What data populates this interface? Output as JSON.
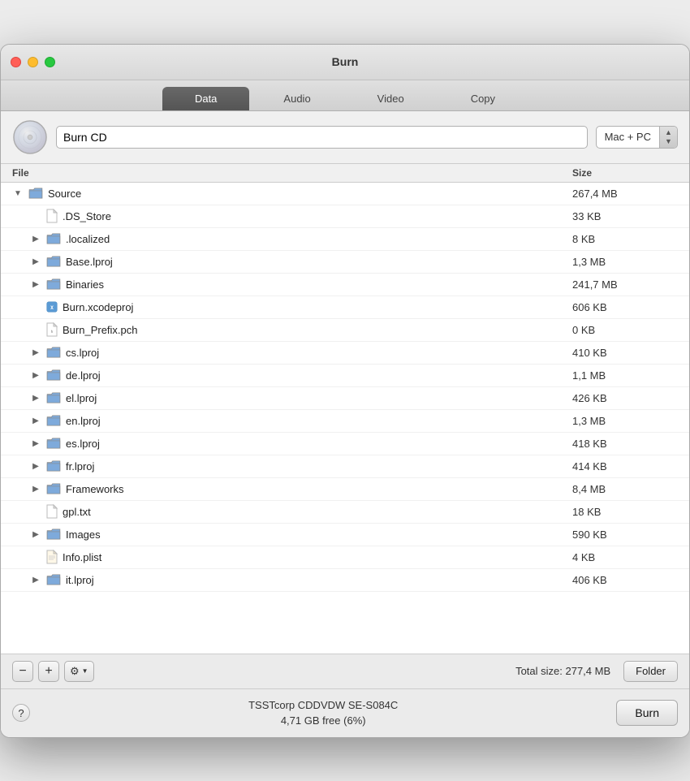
{
  "window": {
    "title": "Burn"
  },
  "tabs": [
    {
      "id": "data",
      "label": "Data",
      "active": true
    },
    {
      "id": "audio",
      "label": "Audio",
      "active": false
    },
    {
      "id": "video",
      "label": "Video",
      "active": false
    },
    {
      "id": "copy",
      "label": "Copy",
      "active": false
    }
  ],
  "toolbar": {
    "disc_alt": "Disc",
    "burn_name": "Burn CD",
    "format_label": "Mac + PC",
    "format_arrow_up": "▲",
    "format_arrow_down": "▼"
  },
  "columns": {
    "file": "File",
    "size": "Size"
  },
  "files": [
    {
      "indent": 0,
      "expanded": true,
      "expandable": true,
      "type": "folder",
      "name": "Source",
      "size": "267,4 MB"
    },
    {
      "indent": 1,
      "expanded": false,
      "expandable": false,
      "type": "file-plain",
      "name": ".DS_Store",
      "size": "33 KB"
    },
    {
      "indent": 1,
      "expanded": false,
      "expandable": true,
      "type": "folder",
      "name": ".localized",
      "size": "8 KB"
    },
    {
      "indent": 1,
      "expanded": false,
      "expandable": true,
      "type": "folder",
      "name": "Base.lproj",
      "size": "1,3 MB"
    },
    {
      "indent": 1,
      "expanded": false,
      "expandable": true,
      "type": "folder",
      "name": "Binaries",
      "size": "241,7 MB"
    },
    {
      "indent": 1,
      "expanded": false,
      "expandable": false,
      "type": "file-xcode",
      "name": "Burn.xcodeproj",
      "size": "606 KB"
    },
    {
      "indent": 1,
      "expanded": false,
      "expandable": false,
      "type": "file-h",
      "name": "Burn_Prefix.pch",
      "size": "0 KB"
    },
    {
      "indent": 1,
      "expanded": false,
      "expandable": true,
      "type": "folder",
      "name": "cs.lproj",
      "size": "410 KB"
    },
    {
      "indent": 1,
      "expanded": false,
      "expandable": true,
      "type": "folder",
      "name": "de.lproj",
      "size": "1,1 MB"
    },
    {
      "indent": 1,
      "expanded": false,
      "expandable": true,
      "type": "folder",
      "name": "el.lproj",
      "size": "426 KB"
    },
    {
      "indent": 1,
      "expanded": false,
      "expandable": true,
      "type": "folder",
      "name": "en.lproj",
      "size": "1,3 MB"
    },
    {
      "indent": 1,
      "expanded": false,
      "expandable": true,
      "type": "folder",
      "name": "es.lproj",
      "size": "418 KB"
    },
    {
      "indent": 1,
      "expanded": false,
      "expandable": true,
      "type": "folder",
      "name": "fr.lproj",
      "size": "414 KB"
    },
    {
      "indent": 1,
      "expanded": false,
      "expandable": true,
      "type": "folder",
      "name": "Frameworks",
      "size": "8,4 MB"
    },
    {
      "indent": 1,
      "expanded": false,
      "expandable": false,
      "type": "file-plain",
      "name": "gpl.txt",
      "size": "18 KB"
    },
    {
      "indent": 1,
      "expanded": false,
      "expandable": true,
      "type": "folder",
      "name": "Images",
      "size": "590 KB"
    },
    {
      "indent": 1,
      "expanded": false,
      "expandable": false,
      "type": "file-plist",
      "name": "Info.plist",
      "size": "4 KB"
    },
    {
      "indent": 1,
      "expanded": false,
      "expandable": true,
      "type": "folder",
      "name": "it.lproj",
      "size": "406 KB"
    }
  ],
  "bottombar": {
    "minus_label": "−",
    "plus_label": "+",
    "gear_label": "⚙",
    "gear_arrow": "▼",
    "total_size": "Total size: 277,4 MB",
    "folder_btn": "Folder"
  },
  "statusbar": {
    "help_label": "?",
    "device_name": "TSSTcorp CDDVDW SE-S084C",
    "device_free": "4,71 GB free (6%)",
    "burn_btn": "Burn"
  }
}
